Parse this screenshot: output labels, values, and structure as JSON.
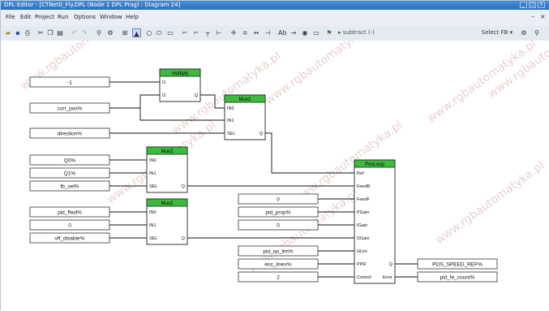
{
  "window": {
    "title": "DPL Editor - [CTNet0_Fly.DPL (Node 1 DPL Prog) : Diagram 24]",
    "buttons": [
      "_",
      "□",
      "×"
    ]
  },
  "menu": {
    "items": [
      "File",
      "Edit",
      "Project",
      "Run",
      "Options",
      "Window",
      "Help"
    ],
    "mdi_controls": [
      "–",
      "×"
    ]
  },
  "toolbar": {
    "function_label": "subtract (-)",
    "select_fb": "Select FB ▾"
  },
  "watermark": "www.rgbautomatyka.pl",
  "inputs": {
    "const_minus1": "-1",
    "curr_pos": "curr_pos%",
    "direction": "direction%",
    "q0": "Q0%",
    "q1": "Q1%",
    "fb_sel": "fb_sel%",
    "pid_ffwd": "pid_ffwd%",
    "const_0_mux": "0",
    "vff_disable": "vff_disable%",
    "feedf_val": "0",
    "pid_prop": "pid_prop%",
    "igain_val": "0",
    "dgain_val": "0",
    "pid_op_lim": "pid_op_lim%",
    "enc_lines": "enc_lines%",
    "control_val": "2"
  },
  "outputs": {
    "pos_speed_ref": "POS_SPEED_REF%",
    "pid_fe_count": "pid_fe_count%"
  },
  "blocks": {
    "multiply": {
      "title": "multiply",
      "pins_in": [
        "I1",
        "I2"
      ],
      "pin_out": "Q"
    },
    "mux1": {
      "title": "Mux2",
      "pins_in": [
        "IN0",
        "IN1",
        "SEL"
      ],
      "pin_out": "Q"
    },
    "mux2": {
      "title": "Mux2",
      "pins_in": [
        "IN0",
        "IN1",
        "SEL"
      ],
      "pin_out": "Q"
    },
    "mux3": {
      "title": "Mux2",
      "pins_in": [
        "IN0",
        "IN1",
        "SEL"
      ],
      "pin_out": "Q"
    },
    "posloop": {
      "title": "PosLoop",
      "pins_in": [
        "Ref",
        "FeedB",
        "FeedF",
        "PGain",
        "IGain",
        "DGain",
        "HLim",
        "PPR",
        "Control"
      ],
      "pins_out": [
        "Q",
        "Error"
      ]
    }
  },
  "colors": {
    "block_header": "#3dbb3d",
    "titlebar": "#2a6ebf",
    "watermark": "#d8a9a9"
  }
}
